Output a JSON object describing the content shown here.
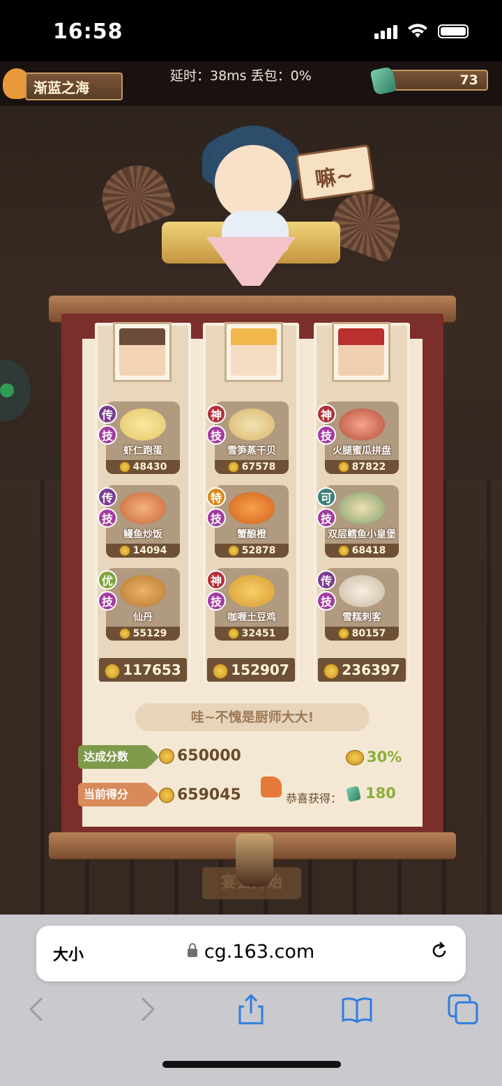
{
  "status_bar": {
    "time": "16:58"
  },
  "top_bar": {
    "player_name": "渐蓝之海",
    "network": "延时：38ms 丢包：0%",
    "gems": "73"
  },
  "speech_bubble": "嘛~",
  "columns": [
    {
      "dishes": [
        {
          "rank": "传",
          "skill": "技",
          "name": "虾仁跑蛋",
          "score": "48430"
        },
        {
          "rank": "传",
          "skill": "技",
          "name": "鳗鱼炒饭",
          "score": "14094"
        },
        {
          "rank": "优",
          "skill": "技",
          "name": "仙丹",
          "score": "55129"
        }
      ],
      "total": "117653"
    },
    {
      "dishes": [
        {
          "rank": "神",
          "skill": "技",
          "name": "雪笋蒸干贝",
          "score": "67578"
        },
        {
          "rank": "特",
          "skill": "技",
          "name": "蟹酿橙",
          "score": "52878"
        },
        {
          "rank": "神",
          "skill": "技",
          "name": "咖喱土豆鸡",
          "score": "32451"
        }
      ],
      "total": "152907"
    },
    {
      "dishes": [
        {
          "rank": "神",
          "skill": "技",
          "name": "火腿蜜瓜拼盘",
          "score": "87822"
        },
        {
          "rank": "可",
          "skill": "技",
          "name": "双层鳕鱼小皇堡",
          "score": "68418"
        },
        {
          "rank": "传",
          "skill": "技",
          "name": "雪糕刺客",
          "score": "80157"
        }
      ],
      "total": "236397"
    }
  ],
  "praise": "哇~不愧是厨师大大!",
  "target": {
    "label": "达成分数",
    "value": "650000",
    "percent": "30%"
  },
  "current": {
    "label": "当前得分",
    "value": "659045",
    "reward_label": "恭喜获得：",
    "reward_value": "180"
  },
  "start_button": "宴会开始",
  "browser": {
    "text_size": "大小",
    "url": "cg.163.com"
  },
  "colors": {
    "legend_rank": "#7a3d8f",
    "epic_rank": "#b3303a",
    "special_rank": "#d98a1c",
    "good_rank": "#7fa43a",
    "ok_rank": "#3e7f7a",
    "skill": "#a23ca0"
  },
  "icons": [
    "signal-icon",
    "wifi-icon",
    "battery-icon",
    "gem-icon",
    "coin-icon",
    "thumbs-up-icon",
    "lock-icon",
    "reload-icon",
    "back-icon",
    "forward-icon",
    "share-icon",
    "bookmarks-icon",
    "tabs-icon"
  ]
}
